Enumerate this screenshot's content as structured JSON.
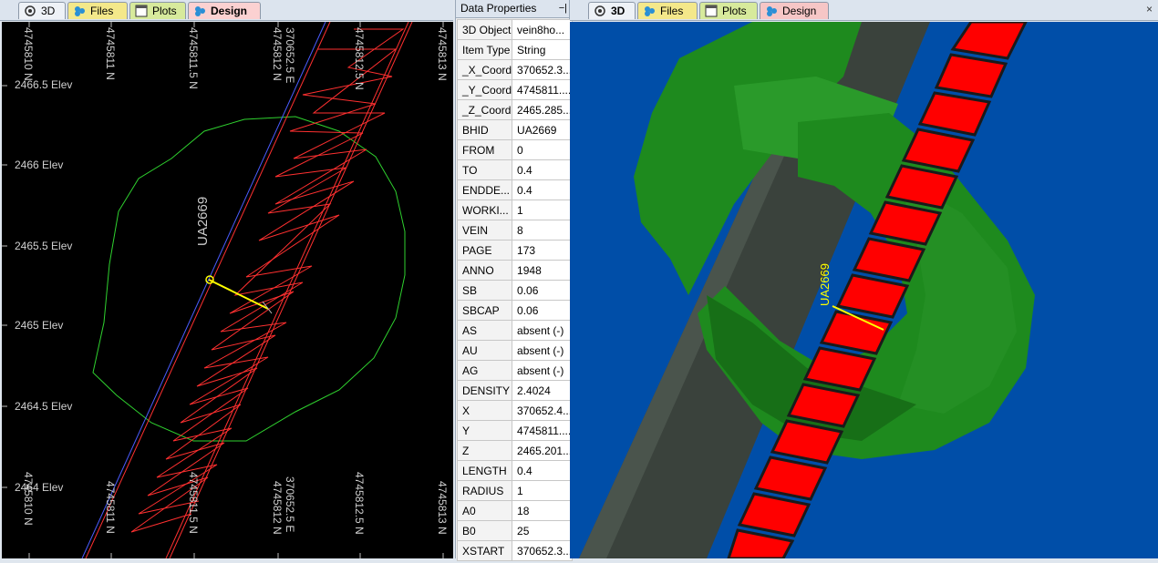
{
  "left_pane": {
    "tabs": [
      {
        "label": "3D",
        "icon": "3d-icon"
      },
      {
        "label": "Files",
        "icon": "files-icon"
      },
      {
        "label": "Plots",
        "icon": "plots-icon"
      },
      {
        "label": "Design",
        "icon": "design-icon"
      }
    ],
    "top_labels": [
      "4745810 N",
      "4745811 N",
      "4745811.5 N",
      "4745812 N",
      "370652.5 E",
      "4745812.5 N",
      "4745813 N"
    ],
    "bottom_labels": [
      "4745810 N",
      "4745811 N",
      "4745811.5 N",
      "4745812 N",
      "370652.5 E",
      "4745812.5 N",
      "4745813 N"
    ],
    "elev_labels": [
      "2466.5 Elev",
      "2466 Elev",
      "2465.5 Elev",
      "2465 Elev",
      "2464.5 Elev",
      "2464 Elev"
    ],
    "hole_label": "UA2669"
  },
  "properties": {
    "title": "Data Properties",
    "rows": [
      {
        "k": "3D Object",
        "v": "vein8ho..."
      },
      {
        "k": "Item Type",
        "v": "String"
      },
      {
        "k": "_X_Coord",
        "v": "370652.3..."
      },
      {
        "k": "_Y_Coord",
        "v": "4745811...."
      },
      {
        "k": "_Z_Coord",
        "v": "2465.285..."
      },
      {
        "k": "BHID",
        "v": "UA2669"
      },
      {
        "k": "FROM",
        "v": "0"
      },
      {
        "k": "TO",
        "v": "0.4"
      },
      {
        "k": "ENDDE...",
        "v": "0.4"
      },
      {
        "k": "WORKI...",
        "v": "1"
      },
      {
        "k": "VEIN",
        "v": "8"
      },
      {
        "k": "PAGE",
        "v": "173"
      },
      {
        "k": "ANNO",
        "v": "1948"
      },
      {
        "k": "SB",
        "v": "0.06"
      },
      {
        "k": "SBCAP",
        "v": "0.06"
      },
      {
        "k": "AS",
        "v": "absent (-)"
      },
      {
        "k": "AU",
        "v": "absent (-)"
      },
      {
        "k": "AG",
        "v": "absent (-)"
      },
      {
        "k": "DENSITY",
        "v": "2.4024"
      },
      {
        "k": "X",
        "v": "370652.4..."
      },
      {
        "k": "Y",
        "v": "4745811...."
      },
      {
        "k": "Z",
        "v": "2465.201..."
      },
      {
        "k": "LENGTH",
        "v": "0.4"
      },
      {
        "k": "RADIUS",
        "v": "1"
      },
      {
        "k": "A0",
        "v": "18"
      },
      {
        "k": "B0",
        "v": "25"
      },
      {
        "k": "XSTART",
        "v": "370652.3..."
      }
    ]
  },
  "right_pane": {
    "tabs": [
      {
        "label": "3D",
        "icon": "3d-icon"
      },
      {
        "label": "Files",
        "icon": "files-icon"
      },
      {
        "label": "Plots",
        "icon": "plots-icon"
      },
      {
        "label": "Design",
        "icon": "design-icon"
      }
    ],
    "close_label": "×",
    "hole_label": "UA2669"
  },
  "colors": {
    "viewport_left": "#000000",
    "viewport_right": "#004ea8",
    "hole_line": "#ffff00",
    "shell": "#1e8a1e",
    "vein": "#ff0000"
  }
}
